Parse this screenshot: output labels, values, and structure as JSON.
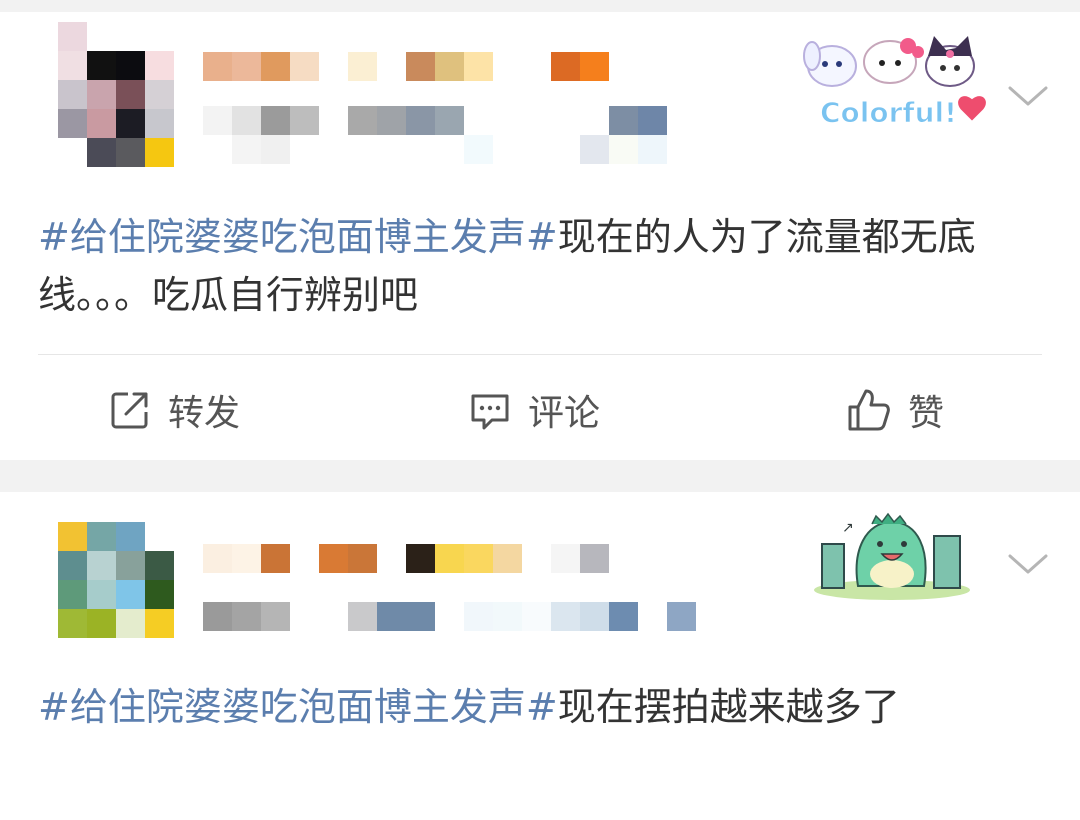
{
  "theme": {
    "tag_color": "#5b7eae",
    "text_color": "#333333",
    "action_color": "#555555",
    "background": "#f2f2f2"
  },
  "posts": [
    {
      "avatar": "pixelated",
      "name": "pixelated",
      "meta": "pixelated",
      "sticker": {
        "icon": "hello-kitty-colorful-sticker",
        "text": "Colorful!"
      },
      "hashtag": "#给住院婆婆吃泡面博主发声#",
      "text": "现在的人为了流量都无底线。。。吃瓜自行辨别吧",
      "actions": [
        {
          "icon": "repost-icon",
          "label": "转发"
        },
        {
          "icon": "comment-icon",
          "label": "评论"
        },
        {
          "icon": "like-icon",
          "label": "赞"
        }
      ]
    },
    {
      "avatar": "pixelated",
      "name": "pixelated",
      "meta": "pixelated",
      "sticker": {
        "icon": "green-dinosaur-sticker"
      },
      "hashtag": "#给住院婆婆吃泡面博主发声#",
      "text": "现在摆拍越来越多了"
    }
  ]
}
